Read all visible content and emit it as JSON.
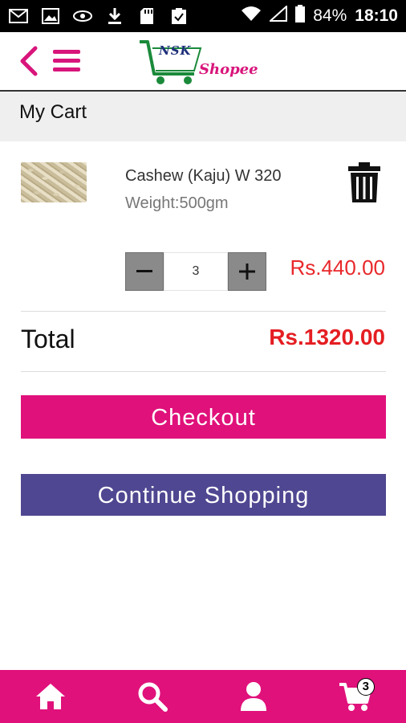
{
  "status_bar": {
    "battery_percent": "84%",
    "time": "18:10",
    "icons": [
      "gmail-icon",
      "gallery-icon",
      "eye-icon",
      "download-icon",
      "sd-card-icon",
      "clipboard-check-icon",
      "wifi-icon",
      "signal-icon",
      "battery-icon"
    ]
  },
  "app_bar": {
    "logo_nsk": "NSK",
    "logo_shopee": "Shopee"
  },
  "page": {
    "title": "My Cart"
  },
  "cart_item": {
    "name": "Cashew (Kaju) W 320",
    "weight": "Weight:500gm",
    "quantity": "3",
    "price": "Rs.440.00"
  },
  "totals": {
    "label": "Total",
    "value": "Rs.1320.00"
  },
  "buttons": {
    "checkout": "Checkout",
    "continue_shopping": "Continue Shopping"
  },
  "bottom_nav": {
    "items": [
      "home-icon",
      "search-icon",
      "user-icon",
      "cart-icon"
    ],
    "cart_count": "3"
  },
  "colors": {
    "brand_pink": "#e0117b",
    "continue_purple": "#4f4791",
    "price_red": "#e8282b",
    "logo_green": "#1a8a3a"
  }
}
